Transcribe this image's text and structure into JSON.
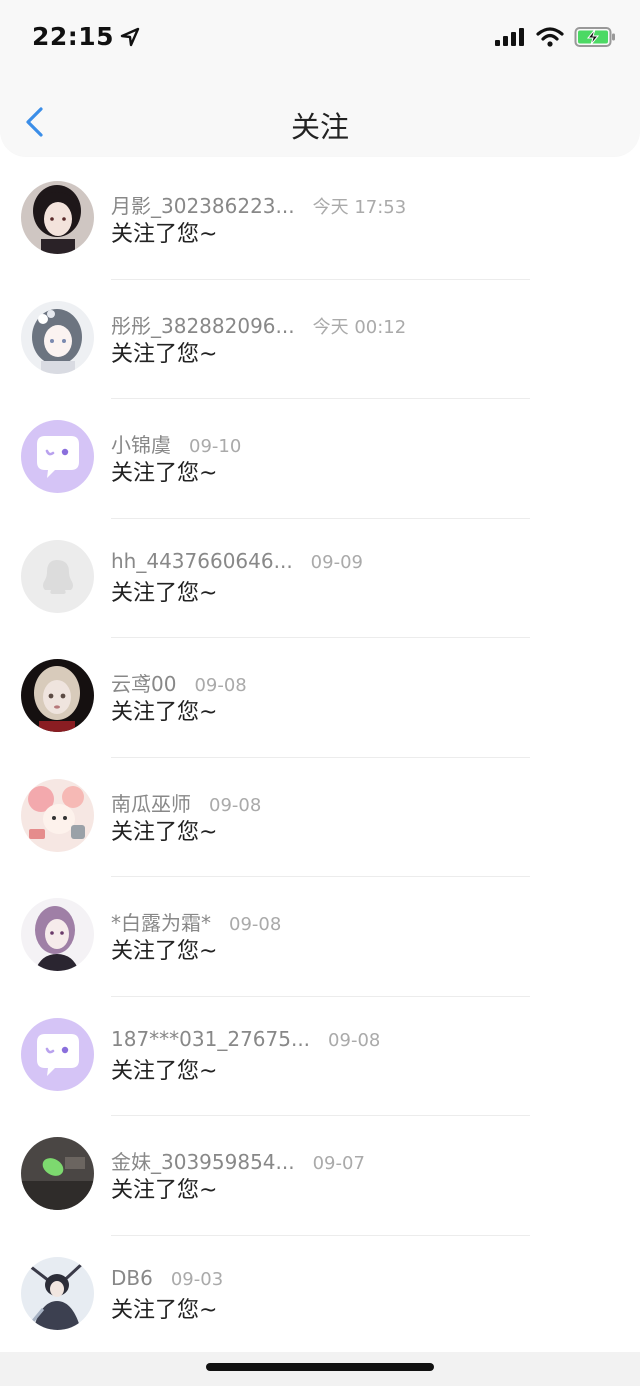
{
  "status_bar": {
    "time": "22:15"
  },
  "header": {
    "title": "关注"
  },
  "items": [
    {
      "name": "月影_302386223...",
      "time": "今天 17:53",
      "message": "关注了您~",
      "avatar": "dark-haired-girl"
    },
    {
      "name": "彤彤_382882096...",
      "time": "今天 00:12",
      "message": "关注了您~",
      "avatar": "anime-girl-flowers"
    },
    {
      "name": "小锦虞",
      "time": "09-10",
      "message": "关注了您~",
      "avatar": "default-chat-bubble"
    },
    {
      "name": "hh_4437660646...",
      "time": "09-09",
      "message": "关注了您~",
      "avatar": "default-penguin"
    },
    {
      "name": "云鸢00",
      "time": "09-08",
      "message": "关注了您~",
      "avatar": "blonde-doll"
    },
    {
      "name": "南瓜巫师",
      "time": "09-08",
      "message": "关注了您~",
      "avatar": "pink-cartoon"
    },
    {
      "name": "*白露为霜*",
      "time": "09-08",
      "message": "关注了您~",
      "avatar": "purple-hair-anime"
    },
    {
      "name": "187***031_27675...",
      "time": "09-08",
      "message": "关注了您~",
      "avatar": "default-chat-bubble"
    },
    {
      "name": "金妹_303959854...",
      "time": "09-07",
      "message": "关注了您~",
      "avatar": "green-leaf-photo"
    },
    {
      "name": "DB6",
      "time": "09-03",
      "message": "关注了您~",
      "avatar": "anime-warrior"
    }
  ],
  "colors": {
    "accent": "#3b8ee8",
    "default_avatar_purple": "#d5c4f6"
  }
}
